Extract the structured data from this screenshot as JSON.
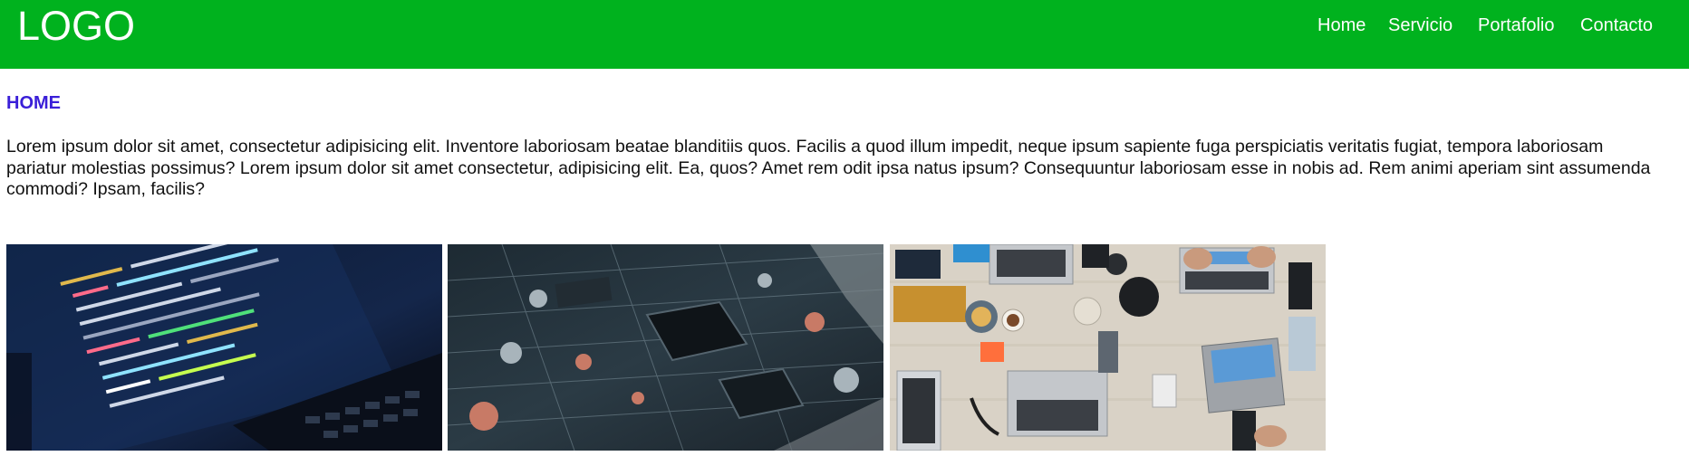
{
  "header": {
    "logo": "LOGO",
    "background": "#00b21e"
  },
  "nav": {
    "items": [
      "Home",
      "Servicio",
      "Portafolio",
      "Contacto"
    ]
  },
  "main": {
    "heading": "HOME",
    "heading_color": "#3a1fd8",
    "paragraph_lines": [
      "Lorem ipsum dolor sit amet, consectetur adipisicing elit. Inventore laboriosam beatae blanditiis quos. Facilis a quod illum impedit, neque ipsum sapiente fuga perspiciatis veritatis fugiat, tempora laboriosam",
      "pariatur molestias possimus? Lorem ipsum dolor sit amet consectetur, adipisicing elit. Ea, quos? Amet rem odit ipsa natus ipsum? Consequuntur laboriosam esse in nobis ad. Rem animi aperiam sint assumenda",
      "commodi? Ipsam, facilis?"
    ]
  },
  "gallery": {
    "images": [
      "code-on-laptop-photo",
      "circuit-board-photo",
      "team-desk-laptops-photo"
    ]
  }
}
